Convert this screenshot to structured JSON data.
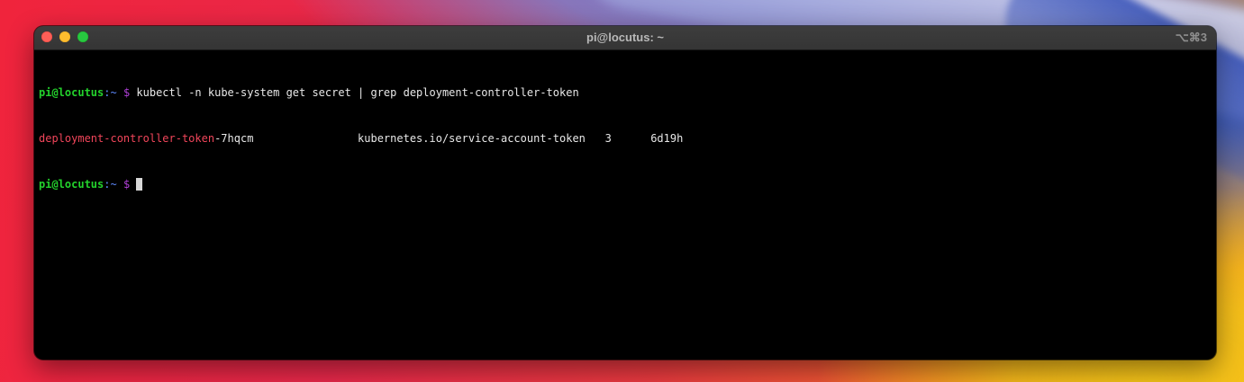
{
  "window": {
    "title": "pi@locutus: ~",
    "shortcut": "⌥⌘3"
  },
  "terminal": {
    "line1": {
      "user_host": "pi@locutus",
      "sep": ":",
      "path": "~",
      "symbol": " $",
      "command": " kubectl -n kube-system get secret | grep deployment-controller-token"
    },
    "line2": {
      "match": "deployment-controller-token",
      "name_suffix": "-7hqcm",
      "type": "kubernetes.io/service-account-token",
      "data": "3",
      "age": "6d19h"
    },
    "line3": {
      "user_host": "pi@locutus",
      "sep": ":",
      "path": "~",
      "symbol": " $",
      "input": " "
    }
  },
  "colors": {
    "prompt_user": "#23d12c",
    "prompt_path": "#5e8bff",
    "prompt_symbol": "#b040d8",
    "grep_match": "#f0455a"
  }
}
